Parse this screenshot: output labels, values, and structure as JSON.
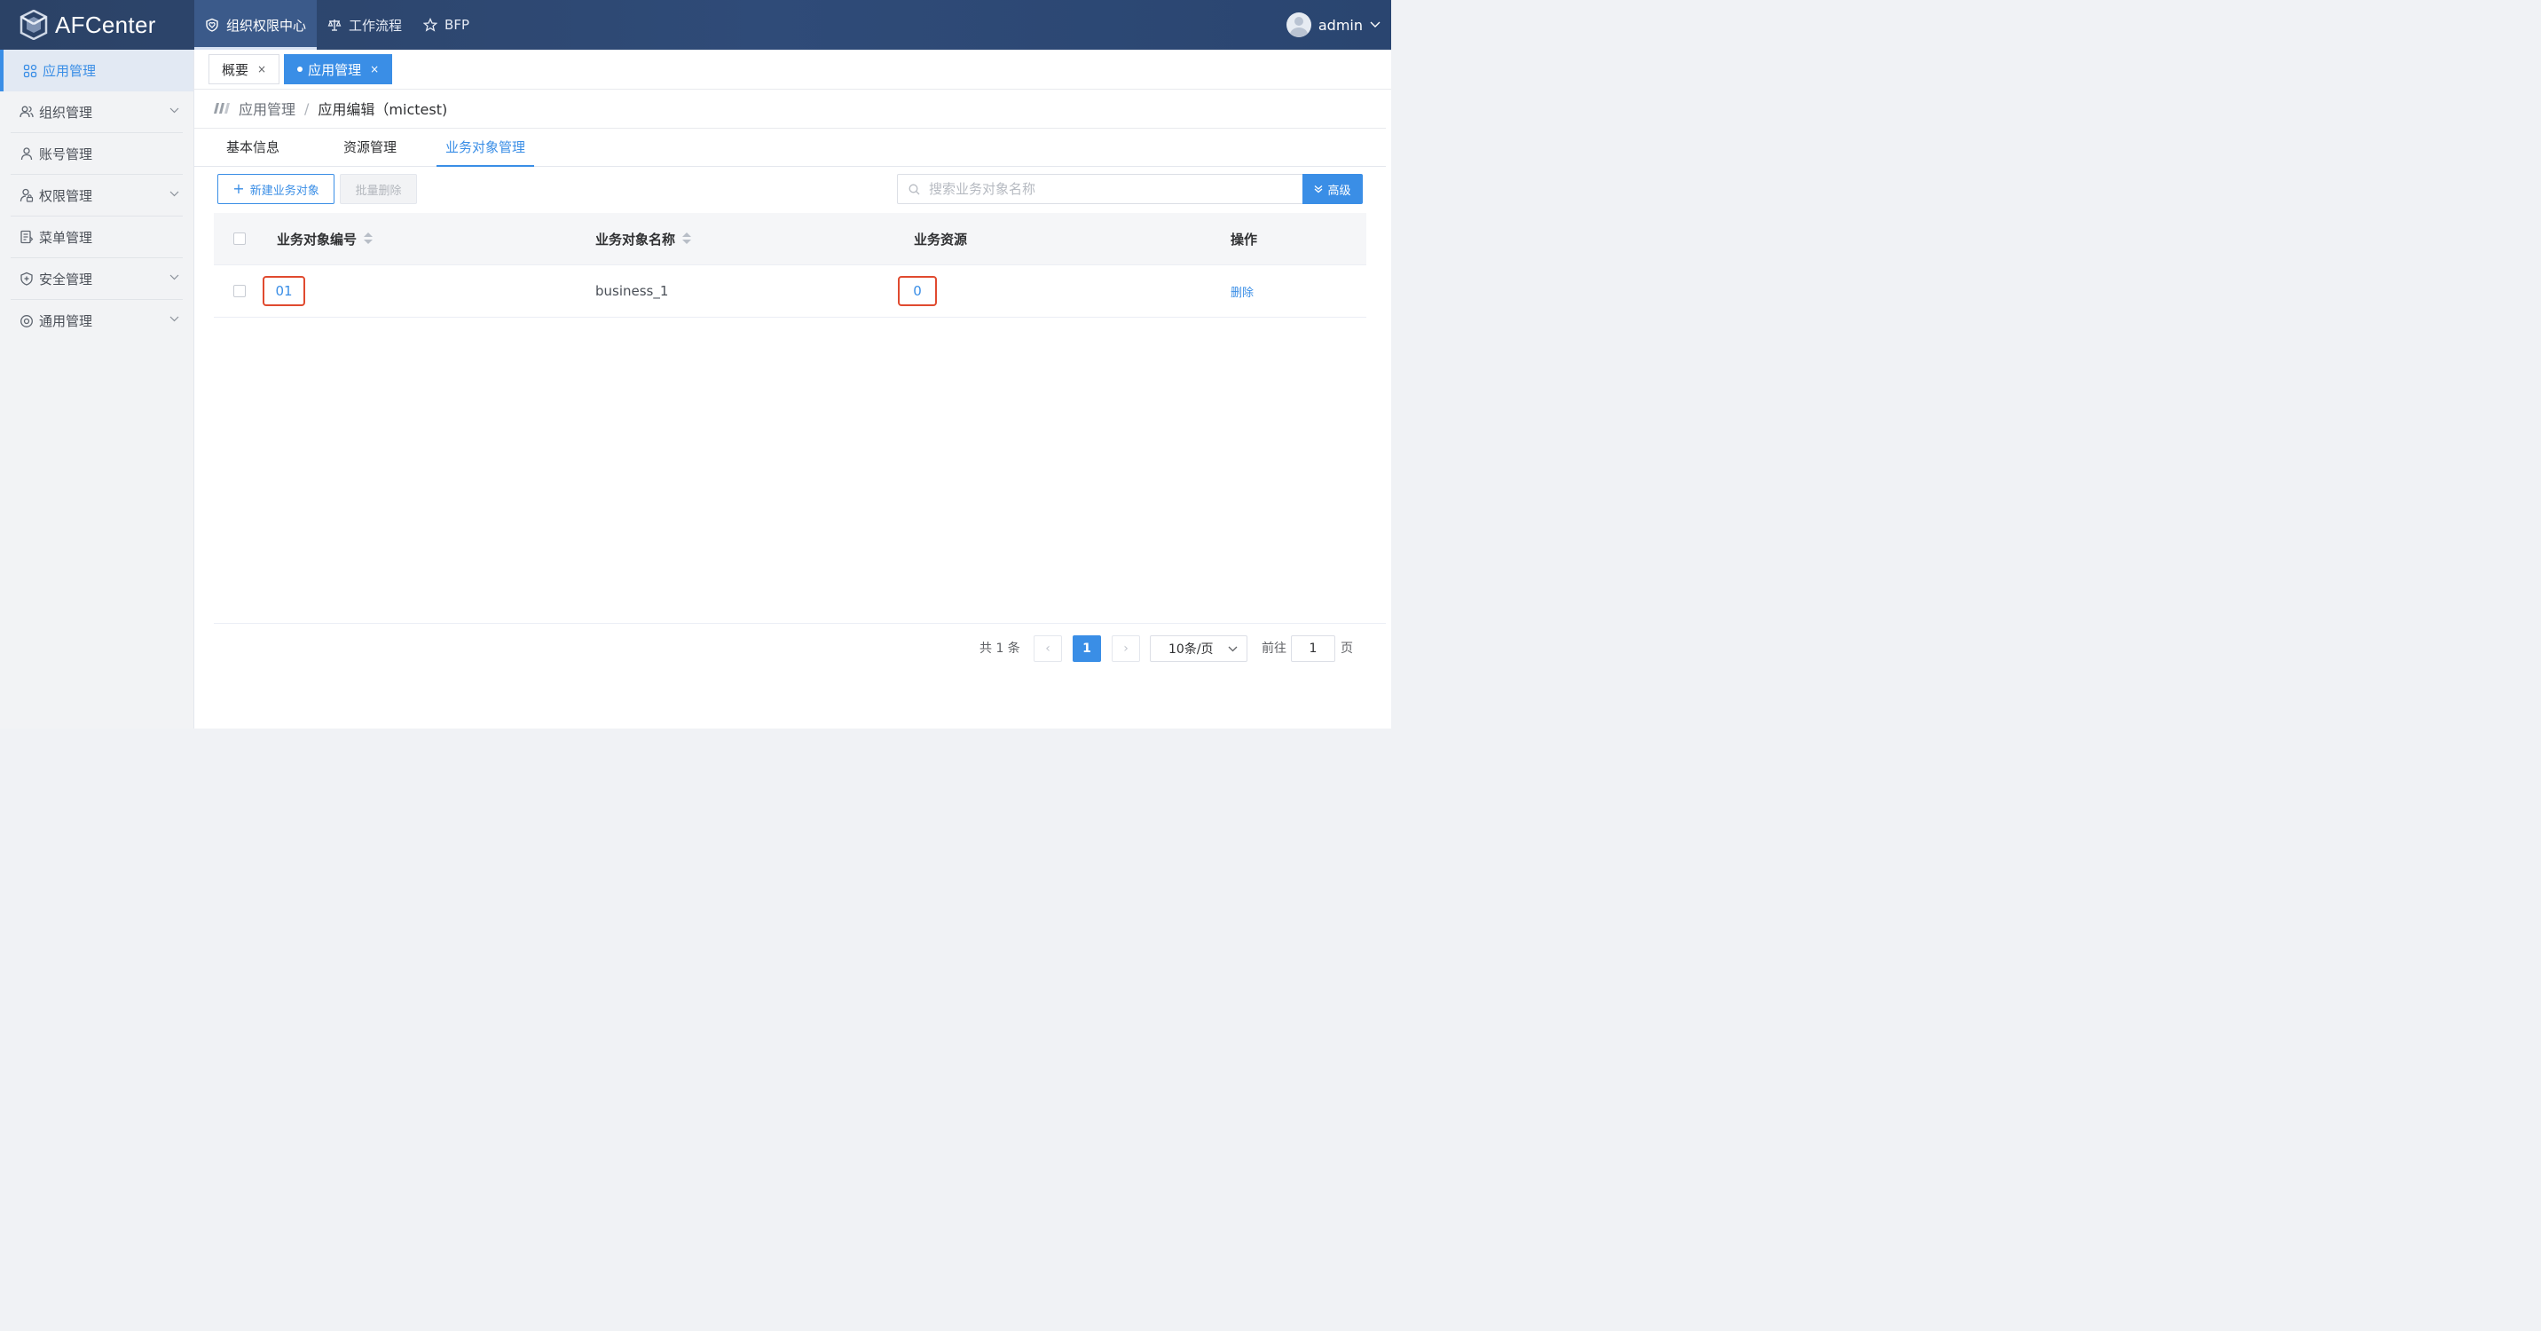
{
  "app": {
    "logo_text": "AFCenter"
  },
  "topnav": [
    {
      "label": "组织权限中心",
      "active": true
    },
    {
      "label": "工作流程",
      "active": false
    },
    {
      "label": "BFP",
      "active": false
    }
  ],
  "user": {
    "name": "admin"
  },
  "sidebar": {
    "items": [
      {
        "label": "应用管理",
        "icon": "grid-apps-icon",
        "expandable": false,
        "active": true
      },
      {
        "label": "组织管理",
        "icon": "users-group-icon",
        "expandable": true
      },
      {
        "label": "账号管理",
        "icon": "user-icon",
        "expandable": false
      },
      {
        "label": "权限管理",
        "icon": "user-lock-icon",
        "expandable": true
      },
      {
        "label": "菜单管理",
        "icon": "menu-doc-icon",
        "expandable": false
      },
      {
        "label": "安全管理",
        "icon": "shield-plus-icon",
        "expandable": true
      },
      {
        "label": "通用管理",
        "icon": "settings-circle-icon",
        "expandable": true
      }
    ]
  },
  "page_tabs": [
    {
      "label": "概要",
      "close": "×",
      "active": false
    },
    {
      "label": "应用管理",
      "close": "×",
      "active": true
    }
  ],
  "breadcrumb": {
    "parent": "应用管理",
    "separator": "/",
    "current": "应用编辑（mictest)"
  },
  "subtabs": [
    {
      "label": "基本信息",
      "active": false
    },
    {
      "label": "资源管理",
      "active": false
    },
    {
      "label": "业务对象管理",
      "active": true
    }
  ],
  "toolbar": {
    "new_plus": "+",
    "new_label": "新建业务对象",
    "batch_delete_label": "批量删除",
    "search_placeholder": "搜索业务对象名称",
    "advanced_label": "高级"
  },
  "table": {
    "headers": {
      "code": "业务对象编号",
      "name": "业务对象名称",
      "resource": "业务资源",
      "action": "操作"
    },
    "rows": [
      {
        "code": "01",
        "name": "business_1",
        "resource": "0",
        "action": "删除"
      }
    ]
  },
  "pagination": {
    "total_text": "共 1 条",
    "prev": "‹",
    "next": "›",
    "current_page": "1",
    "page_size": "10条/页",
    "goto_label": "前往",
    "goto_value": "1",
    "page_unit": "页"
  },
  "colors": {
    "primary": "#3a8ee6",
    "header_bg": "#2f4b78",
    "highlight": "#e04a2f"
  }
}
